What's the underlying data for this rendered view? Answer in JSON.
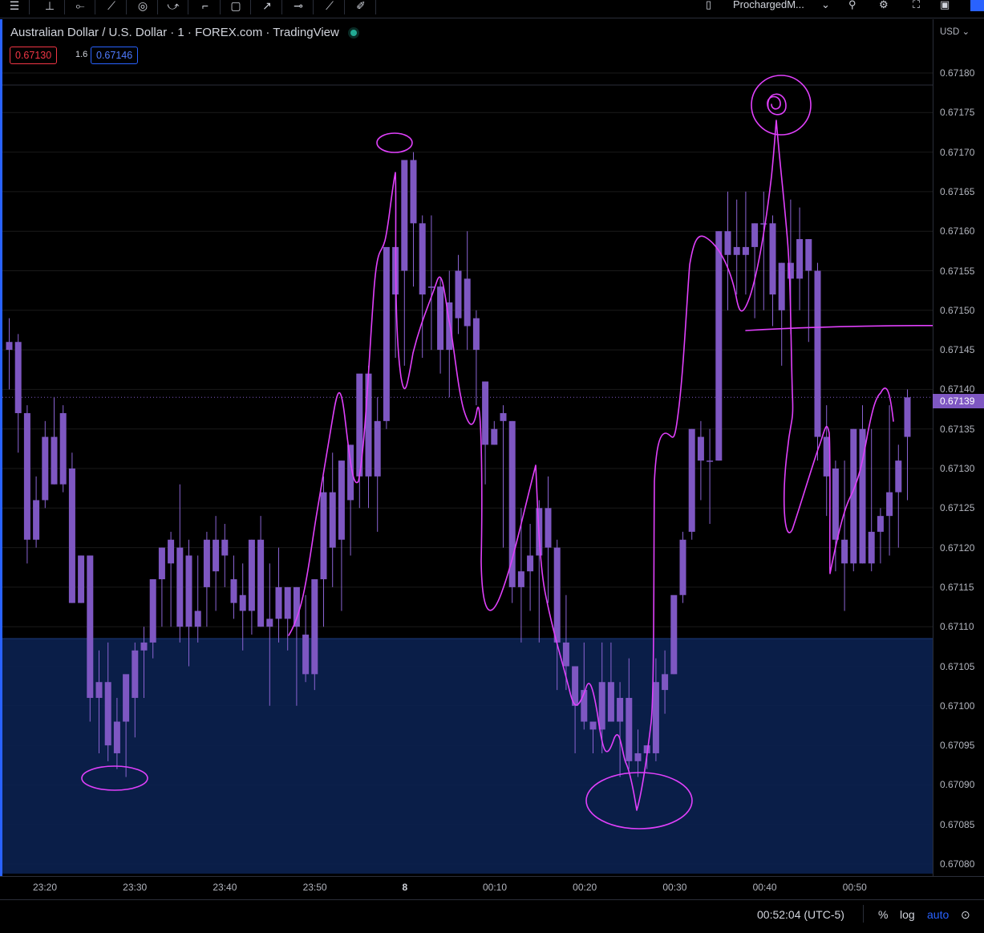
{
  "toolbar": {
    "layout_name": "ProchargedM...",
    "tools": [
      "menu-icon",
      "cursor-icon",
      "trend-line-icon",
      "brush-icon",
      "measure-icon",
      "pattern-icon",
      "callout-icon",
      "rectangle-icon",
      "arrow-icon",
      "horizontal-line-icon",
      "ray-icon",
      "eraser-icon"
    ]
  },
  "legend": {
    "symbol": "Australian Dollar / U.S. Dollar · 1 · FOREX.com · TradingView",
    "sell_price": "0.67130",
    "spread": "1.6",
    "buy_price": "0.67146"
  },
  "price_axis": {
    "currency": "USD",
    "labels": [
      "0.67180",
      "0.67175",
      "0.67170",
      "0.67165",
      "0.67160",
      "0.67155",
      "0.67150",
      "0.67145",
      "0.67140",
      "0.67135",
      "0.67130",
      "0.67125",
      "0.67120",
      "0.67115",
      "0.67110",
      "0.67105",
      "0.67100",
      "0.67095",
      "0.67090",
      "0.67085",
      "0.67080"
    ],
    "current_price": "0.67139"
  },
  "time_axis": {
    "labels": [
      "23:20",
      "23:30",
      "23:40",
      "23:50",
      "8",
      "00:10",
      "00:20",
      "00:30",
      "00:40",
      "00:50"
    ]
  },
  "bottom_bar": {
    "clock": "00:52:04 (UTC-5)",
    "percent": "%",
    "log": "log",
    "auto": "auto"
  },
  "colors": {
    "candle": "#7e57c2",
    "annotation": "#e040fb",
    "zone": "#0b2150",
    "accent": "#2962ff"
  },
  "chart_data": {
    "type": "candlestick",
    "interval_minutes": 1,
    "ylim": [
      0.6708,
      0.67181
    ],
    "zone": {
      "from": 0.6708,
      "to": 0.671085
    },
    "horizontal_line": 0.67149,
    "candles": [
      {
        "t": "23:16",
        "o": 0.67145,
        "h": 0.67149,
        "l": 0.6714,
        "c": 0.67146
      },
      {
        "t": "23:17",
        "o": 0.67146,
        "h": 0.67147,
        "l": 0.67132,
        "c": 0.67137
      },
      {
        "t": "23:18",
        "o": 0.67137,
        "h": 0.67138,
        "l": 0.67118,
        "c": 0.67121
      },
      {
        "t": "23:19",
        "o": 0.67121,
        "h": 0.67129,
        "l": 0.6712,
        "c": 0.67126
      },
      {
        "t": "23:20",
        "o": 0.67126,
        "h": 0.67136,
        "l": 0.67125,
        "c": 0.67134
      },
      {
        "t": "23:21",
        "o": 0.67134,
        "h": 0.67139,
        "l": 0.67128,
        "c": 0.67128
      },
      {
        "t": "23:22",
        "o": 0.67128,
        "h": 0.67138,
        "l": 0.67127,
        "c": 0.67137
      },
      {
        "t": "23:23",
        "o": 0.6713,
        "h": 0.67132,
        "l": 0.67113,
        "c": 0.67113
      },
      {
        "t": "23:24",
        "o": 0.67113,
        "h": 0.67119,
        "l": 0.67113,
        "c": 0.67119
      },
      {
        "t": "23:25",
        "o": 0.67119,
        "h": 0.67119,
        "l": 0.67098,
        "c": 0.67101
      },
      {
        "t": "23:26",
        "o": 0.67101,
        "h": 0.67107,
        "l": 0.67094,
        "c": 0.67103
      },
      {
        "t": "23:27",
        "o": 0.67103,
        "h": 0.67108,
        "l": 0.67093,
        "c": 0.67095
      },
      {
        "t": "23:28",
        "o": 0.67094,
        "h": 0.67101,
        "l": 0.67092,
        "c": 0.67098
      },
      {
        "t": "23:29",
        "o": 0.67098,
        "h": 0.67103,
        "l": 0.67091,
        "c": 0.67104
      },
      {
        "t": "23:30",
        "o": 0.67101,
        "h": 0.67108,
        "l": 0.67096,
        "c": 0.67107
      },
      {
        "t": "23:31",
        "o": 0.67107,
        "h": 0.6711,
        "l": 0.67101,
        "c": 0.67108
      },
      {
        "t": "23:32",
        "o": 0.67108,
        "h": 0.67116,
        "l": 0.67106,
        "c": 0.67116
      },
      {
        "t": "23:33",
        "o": 0.67116,
        "h": 0.6712,
        "l": 0.6711,
        "c": 0.6712
      },
      {
        "t": "23:34",
        "o": 0.67121,
        "h": 0.67122,
        "l": 0.6711,
        "c": 0.67118
      },
      {
        "t": "23:35",
        "o": 0.6712,
        "h": 0.67128,
        "l": 0.67108,
        "c": 0.6711
      },
      {
        "t": "23:36",
        "o": 0.6711,
        "h": 0.67121,
        "l": 0.67105,
        "c": 0.67119
      },
      {
        "t": "23:37",
        "o": 0.67112,
        "h": 0.67119,
        "l": 0.67108,
        "c": 0.6711
      },
      {
        "t": "23:38",
        "o": 0.67115,
        "h": 0.67122,
        "l": 0.6711,
        "c": 0.67121
      },
      {
        "t": "23:39",
        "o": 0.67121,
        "h": 0.67124,
        "l": 0.67112,
        "c": 0.67117
      },
      {
        "t": "23:40",
        "o": 0.67121,
        "h": 0.67123,
        "l": 0.67115,
        "c": 0.67119
      },
      {
        "t": "23:41",
        "o": 0.67116,
        "h": 0.67119,
        "l": 0.67111,
        "c": 0.67113
      },
      {
        "t": "23:42",
        "o": 0.67114,
        "h": 0.67118,
        "l": 0.67107,
        "c": 0.67112
      },
      {
        "t": "23:43",
        "o": 0.67112,
        "h": 0.67121,
        "l": 0.67109,
        "c": 0.67121
      },
      {
        "t": "23:44",
        "o": 0.67121,
        "h": 0.67124,
        "l": 0.6711,
        "c": 0.6711
      },
      {
        "t": "23:45",
        "o": 0.6711,
        "h": 0.67118,
        "l": 0.671,
        "c": 0.67111
      },
      {
        "t": "23:46",
        "o": 0.67115,
        "h": 0.6712,
        "l": 0.67108,
        "c": 0.67111
      },
      {
        "t": "23:47",
        "o": 0.67111,
        "h": 0.67115,
        "l": 0.67107,
        "c": 0.67115
      },
      {
        "t": "23:48",
        "o": 0.67115,
        "h": 0.67115,
        "l": 0.671,
        "c": 0.6711
      },
      {
        "t": "23:49",
        "o": 0.67109,
        "h": 0.67114,
        "l": 0.67103,
        "c": 0.67104
      },
      {
        "t": "23:50",
        "o": 0.67104,
        "h": 0.67116,
        "l": 0.67102,
        "c": 0.67116
      },
      {
        "t": "23:51",
        "o": 0.67116,
        "h": 0.67129,
        "l": 0.6711,
        "c": 0.67127
      },
      {
        "t": "23:52",
        "o": 0.6712,
        "h": 0.67132,
        "l": 0.67115,
        "c": 0.67127
      },
      {
        "t": "23:53",
        "o": 0.67121,
        "h": 0.67131,
        "l": 0.67112,
        "c": 0.67131
      },
      {
        "t": "23:54",
        "o": 0.67126,
        "h": 0.67133,
        "l": 0.67119,
        "c": 0.67133
      },
      {
        "t": "23:55",
        "o": 0.67129,
        "h": 0.67138,
        "l": 0.67125,
        "c": 0.67142
      },
      {
        "t": "23:56",
        "o": 0.67142,
        "h": 0.67143,
        "l": 0.67125,
        "c": 0.67129
      },
      {
        "t": "23:57",
        "o": 0.67129,
        "h": 0.67139,
        "l": 0.67122,
        "c": 0.67136
      },
      {
        "t": "23:58",
        "o": 0.67136,
        "h": 0.67154,
        "l": 0.67135,
        "c": 0.67158
      },
      {
        "t": "23:59",
        "o": 0.67152,
        "h": 0.67158,
        "l": 0.67144,
        "c": 0.67158
      },
      {
        "t": "00:00",
        "o": 0.67155,
        "h": 0.67169,
        "l": 0.67143,
        "c": 0.67169
      },
      {
        "t": "00:01",
        "o": 0.67169,
        "h": 0.6717,
        "l": 0.67153,
        "c": 0.67161
      },
      {
        "t": "00:02",
        "o": 0.67161,
        "h": 0.67162,
        "l": 0.67144,
        "c": 0.67152
      },
      {
        "t": "00:03",
        "o": 0.67153,
        "h": 0.67162,
        "l": 0.67145,
        "c": 0.67153
      },
      {
        "t": "00:04",
        "o": 0.67153,
        "h": 0.67154,
        "l": 0.67142,
        "c": 0.67145
      },
      {
        "t": "00:05",
        "o": 0.67145,
        "h": 0.67155,
        "l": 0.67139,
        "c": 0.67151
      },
      {
        "t": "00:06",
        "o": 0.67155,
        "h": 0.67157,
        "l": 0.67147,
        "c": 0.67149
      },
      {
        "t": "00:07",
        "o": 0.67154,
        "h": 0.6716,
        "l": 0.67145,
        "c": 0.67148
      },
      {
        "t": "00:08",
        "o": 0.67149,
        "h": 0.6715,
        "l": 0.67138,
        "c": 0.67145
      },
      {
        "t": "00:09",
        "o": 0.67141,
        "h": 0.67141,
        "l": 0.67128,
        "c": 0.67133
      },
      {
        "t": "00:10",
        "o": 0.67135,
        "h": 0.67136,
        "l": 0.67133,
        "c": 0.67133
      },
      {
        "t": "00:11",
        "o": 0.67137,
        "h": 0.67138,
        "l": 0.6712,
        "c": 0.67136
      },
      {
        "t": "00:12",
        "o": 0.67136,
        "h": 0.67136,
        "l": 0.67113,
        "c": 0.67115
      },
      {
        "t": "00:13",
        "o": 0.67115,
        "h": 0.67125,
        "l": 0.67108,
        "c": 0.67117
      },
      {
        "t": "00:14",
        "o": 0.67117,
        "h": 0.67123,
        "l": 0.67112,
        "c": 0.67119
      },
      {
        "t": "00:15",
        "o": 0.67119,
        "h": 0.67126,
        "l": 0.67108,
        "c": 0.67125
      },
      {
        "t": "00:16",
        "o": 0.67125,
        "h": 0.67129,
        "l": 0.67113,
        "c": 0.6712
      },
      {
        "t": "00:17",
        "o": 0.6712,
        "h": 0.67121,
        "l": 0.67102,
        "c": 0.67108
      },
      {
        "t": "00:18",
        "o": 0.67108,
        "h": 0.67114,
        "l": 0.67102,
        "c": 0.67105
      },
      {
        "t": "00:19",
        "o": 0.67105,
        "h": 0.67105,
        "l": 0.67094,
        "c": 0.671
      },
      {
        "t": "00:20",
        "o": 0.67102,
        "h": 0.67108,
        "l": 0.67097,
        "c": 0.67098
      },
      {
        "t": "00:21",
        "o": 0.67098,
        "h": 0.67098,
        "l": 0.67094,
        "c": 0.67097
      },
      {
        "t": "00:22",
        "o": 0.67097,
        "h": 0.67108,
        "l": 0.67094,
        "c": 0.67103
      },
      {
        "t": "00:23",
        "o": 0.67103,
        "h": 0.67108,
        "l": 0.67098,
        "c": 0.67098
      },
      {
        "t": "00:24",
        "o": 0.67098,
        "h": 0.67103,
        "l": 0.67091,
        "c": 0.67101
      },
      {
        "t": "00:25",
        "o": 0.67101,
        "h": 0.67106,
        "l": 0.67092,
        "c": 0.67093
      },
      {
        "t": "00:26",
        "o": 0.67093,
        "h": 0.67097,
        "l": 0.67091,
        "c": 0.67094
      },
      {
        "t": "00:27",
        "o": 0.67095,
        "h": 0.67095,
        "l": 0.67092,
        "c": 0.67094
      },
      {
        "t": "00:28",
        "o": 0.67094,
        "h": 0.67106,
        "l": 0.67093,
        "c": 0.67103
      },
      {
        "t": "00:29",
        "o": 0.67102,
        "h": 0.67107,
        "l": 0.67099,
        "c": 0.67104
      },
      {
        "t": "00:30",
        "o": 0.67104,
        "h": 0.67105,
        "l": 0.67104,
        "c": 0.67114
      },
      {
        "t": "00:31",
        "o": 0.67114,
        "h": 0.67122,
        "l": 0.67113,
        "c": 0.67121
      },
      {
        "t": "00:32",
        "o": 0.67122,
        "h": 0.67135,
        "l": 0.67121,
        "c": 0.67135
      },
      {
        "t": "00:33",
        "o": 0.67134,
        "h": 0.67136,
        "l": 0.67126,
        "c": 0.67131
      },
      {
        "t": "00:34",
        "o": 0.67131,
        "h": 0.67135,
        "l": 0.67123,
        "c": 0.67131
      },
      {
        "t": "00:35",
        "o": 0.67131,
        "h": 0.6716,
        "l": 0.67131,
        "c": 0.6716
      },
      {
        "t": "00:36",
        "o": 0.6716,
        "h": 0.67165,
        "l": 0.6715,
        "c": 0.67157
      },
      {
        "t": "00:37",
        "o": 0.67158,
        "h": 0.67164,
        "l": 0.67152,
        "c": 0.67157
      },
      {
        "t": "00:38",
        "o": 0.67157,
        "h": 0.67165,
        "l": 0.67152,
        "c": 0.67158
      },
      {
        "t": "00:39",
        "o": 0.67161,
        "h": 0.67161,
        "l": 0.67149,
        "c": 0.67158
      },
      {
        "t": "00:40",
        "o": 0.67161,
        "h": 0.67165,
        "l": 0.6715,
        "c": 0.67161
      },
      {
        "t": "00:41",
        "o": 0.67161,
        "h": 0.67162,
        "l": 0.67148,
        "c": 0.67152
      },
      {
        "t": "00:42",
        "o": 0.6715,
        "h": 0.67156,
        "l": 0.67143,
        "c": 0.67156
      },
      {
        "t": "00:43",
        "o": 0.67156,
        "h": 0.67164,
        "l": 0.67147,
        "c": 0.67154
      },
      {
        "t": "00:44",
        "o": 0.67154,
        "h": 0.67163,
        "l": 0.6715,
        "c": 0.67159
      },
      {
        "t": "00:45",
        "o": 0.67159,
        "h": 0.67159,
        "l": 0.67146,
        "c": 0.67155
      },
      {
        "t": "00:46",
        "o": 0.67155,
        "h": 0.67156,
        "l": 0.67131,
        "c": 0.67134
      },
      {
        "t": "00:47",
        "o": 0.67134,
        "h": 0.67138,
        "l": 0.67124,
        "c": 0.67129
      },
      {
        "t": "00:48",
        "o": 0.6713,
        "h": 0.67131,
        "l": 0.67117,
        "c": 0.67121
      },
      {
        "t": "00:49",
        "o": 0.67121,
        "h": 0.67131,
        "l": 0.67112,
        "c": 0.67118
      },
      {
        "t": "00:50",
        "o": 0.67118,
        "h": 0.67135,
        "l": 0.67117,
        "c": 0.67135
      },
      {
        "t": "00:51",
        "o": 0.67135,
        "h": 0.67138,
        "l": 0.67118,
        "c": 0.67118
      },
      {
        "t": "00:52",
        "o": 0.67118,
        "h": 0.67135,
        "l": 0.67117,
        "c": 0.67122
      },
      {
        "t": "00:53",
        "o": 0.67122,
        "h": 0.67125,
        "l": 0.67118,
        "c": 0.67124
      },
      {
        "t": "00:54",
        "o": 0.67124,
        "h": 0.67138,
        "l": 0.67119,
        "c": 0.67127
      },
      {
        "t": "00:55",
        "o": 0.67127,
        "h": 0.67133,
        "l": 0.6712,
        "c": 0.67131
      },
      {
        "t": "00:56",
        "o": 0.67134,
        "h": 0.6714,
        "l": 0.67126,
        "c": 0.67139
      }
    ]
  }
}
